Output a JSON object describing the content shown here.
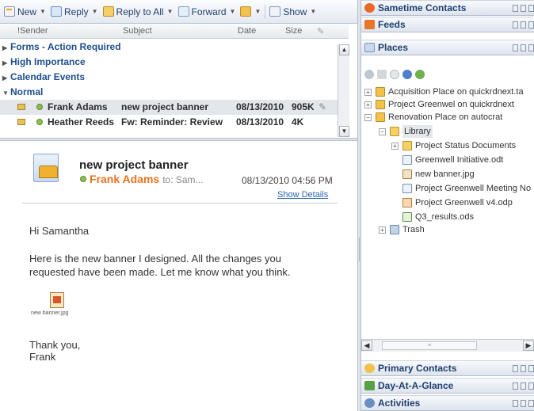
{
  "toolbar": {
    "new_label": "New",
    "reply_label": "Reply",
    "reply_all_label": "Reply to All",
    "forward_label": "Forward",
    "show_label": "Show"
  },
  "columns": {
    "sender": "!Sender",
    "subject": "Subject",
    "date": "Date",
    "size": "Size"
  },
  "groups": [
    {
      "label": "Forms - Action Required",
      "expanded": false
    },
    {
      "label": "High Importance",
      "expanded": false
    },
    {
      "label": "Calendar Events",
      "expanded": false
    },
    {
      "label": "Normal",
      "expanded": true
    }
  ],
  "messages": [
    {
      "sender": "Frank Adams",
      "subject": "new project banner",
      "date": "08/13/2010",
      "size": "905K"
    },
    {
      "sender": "Heather Reeds",
      "subject": "Fw: Reminder: Review",
      "date": "08/13/2010",
      "size": "4K"
    }
  ],
  "preview": {
    "subject": "new project banner",
    "from": "Frank Adams",
    "to": "to: Sam...",
    "date": "08/13/2010 04:56 PM",
    "show_details": "Show Details",
    "greeting": "Hi Samantha",
    "body_line1": "Here is the new banner I designed.  All the changes you",
    "body_line2": "requested have been made. Let me know what you think.",
    "attachment": "new banner.jpg",
    "closing1": "Thank you,",
    "closing2": "Frank"
  },
  "sidebar": {
    "sametime": "Sametime Contacts",
    "feeds": "Feeds",
    "places": "Places",
    "primary": "Primary Contacts",
    "day": "Day-At-A-Glance",
    "activities": "Activities"
  },
  "tree": {
    "acquisition": "Acquisition Place on quickrdnext.ta",
    "greenwell": "Project Greenwel on quickrdnext",
    "renovation": "Renovation Place on autocrat",
    "library": "Library",
    "status_docs": "Project Status Documents",
    "initiative": "Greenwell Initiative.odt",
    "banner": "new banner.jpg",
    "meeting": "Project Greenwell Meeting No",
    "v4": "Project Greenwell v4.odp",
    "q3": "Q3_results.ods",
    "trash": "Trash"
  },
  "colors": {
    "accent": "#1f3f6e",
    "sender_orange": "#e8731f",
    "link": "#2a64b5"
  }
}
